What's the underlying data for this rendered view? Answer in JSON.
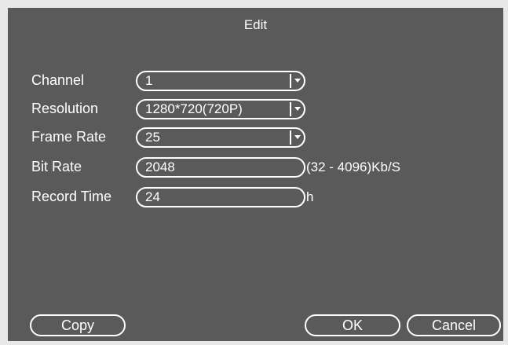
{
  "dialog": {
    "title": "Edit",
    "fields": {
      "channel": {
        "label": "Channel",
        "value": "1"
      },
      "resolution": {
        "label": "Resolution",
        "value": "1280*720(720P)"
      },
      "frame_rate": {
        "label": "Frame Rate",
        "value": "25"
      },
      "bit_rate": {
        "label": "Bit Rate",
        "value": "2048",
        "suffix": "(32 - 4096)Kb/S"
      },
      "record_time": {
        "label": "Record Time",
        "value": "24",
        "suffix": "h"
      }
    },
    "buttons": {
      "copy": "Copy",
      "ok": "OK",
      "cancel": "Cancel"
    }
  },
  "icons": {
    "dropdown": "chevron-down-icon"
  },
  "colors": {
    "panel": "#5a5a5a",
    "border": "#e8e8e8",
    "text": "#ffffff"
  }
}
